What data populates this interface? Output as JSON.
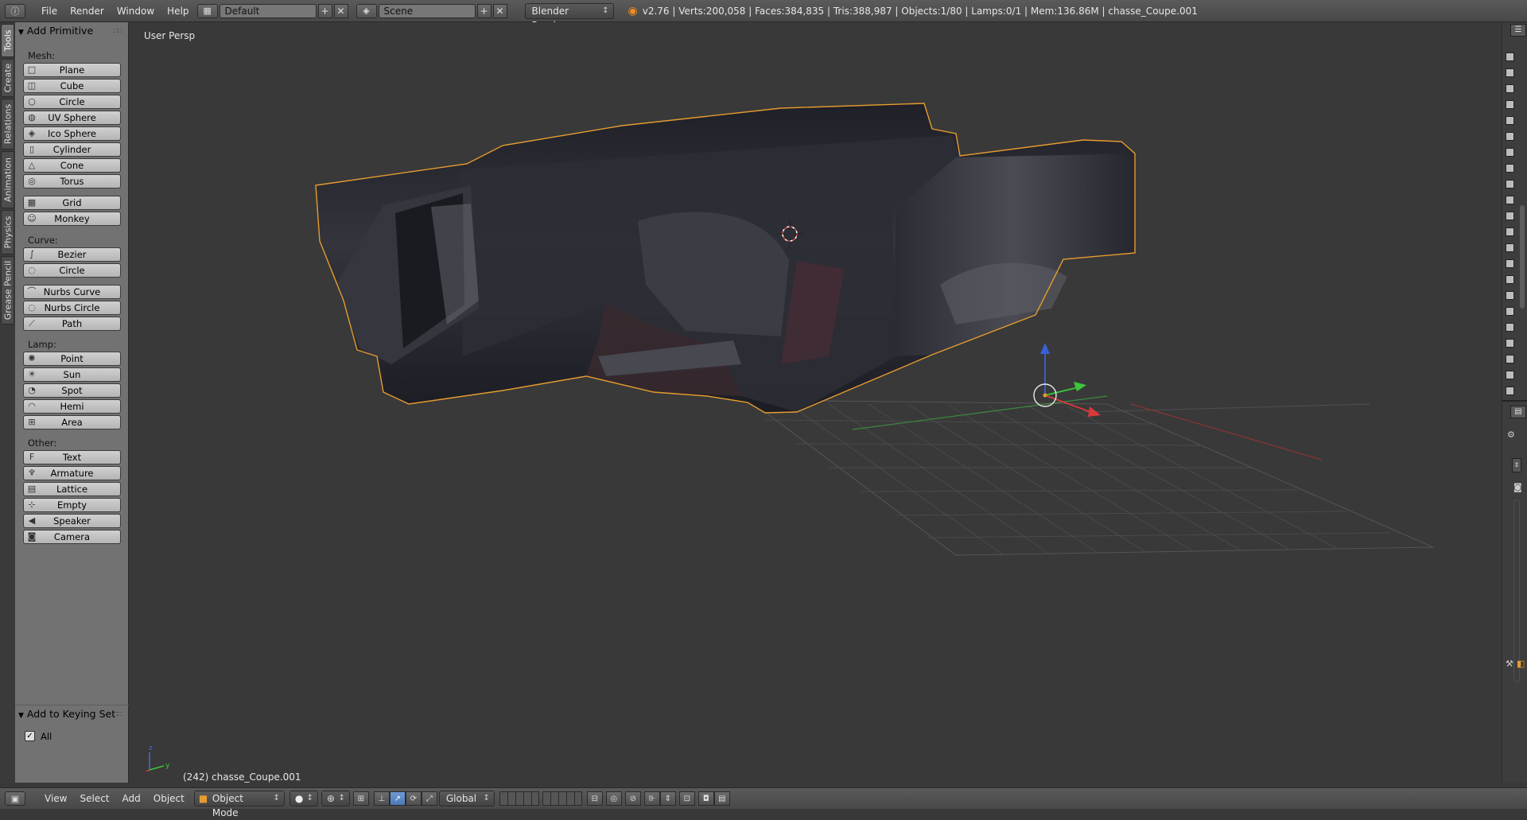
{
  "topbar": {
    "menus": [
      "File",
      "Render",
      "Window",
      "Help"
    ],
    "layout": "Default",
    "scene": "Scene",
    "engine": "Blender Render",
    "stats": "v2.76 | Verts:200,058 | Faces:384,835 | Tris:388,987 | Objects:1/80 | Lamps:0/1 | Mem:136.86M | chasse_Coupe.001"
  },
  "tabs": [
    "Tools",
    "Create",
    "Relations",
    "Animation",
    "Physics",
    "Grease Pencil"
  ],
  "toolshelf": {
    "panel_title": "Add Primitive",
    "sections": {
      "mesh": "Mesh:",
      "curve": "Curve:",
      "lamp": "Lamp:",
      "other": "Other:"
    },
    "mesh": [
      "Plane",
      "Cube",
      "Circle",
      "UV Sphere",
      "Ico Sphere",
      "Cylinder",
      "Cone",
      "Torus"
    ],
    "mesh2": [
      "Grid",
      "Monkey"
    ],
    "curve": [
      "Bezier",
      "Circle"
    ],
    "curve2": [
      "Nurbs Curve",
      "Nurbs Circle",
      "Path"
    ],
    "lamp": [
      "Point",
      "Sun",
      "Spot",
      "Hemi",
      "Area"
    ],
    "other": [
      "Text",
      "Armature",
      "Lattice",
      "Empty",
      "Speaker",
      "Camera"
    ],
    "keying_title": "Add to Keying Set",
    "keying_all": "All"
  },
  "viewport": {
    "view_name": "User Persp",
    "object_info": "(242) chasse_Coupe.001",
    "axis_z": "z",
    "axis_y": "y"
  },
  "bottombar": {
    "menus": [
      "View",
      "Select",
      "Add",
      "Object"
    ],
    "mode": "Object Mode",
    "orientation": "Global"
  },
  "colors": {
    "selection_outline": "#e59b2f",
    "viewport_bg": "#393939",
    "panel_bg": "#727272"
  }
}
